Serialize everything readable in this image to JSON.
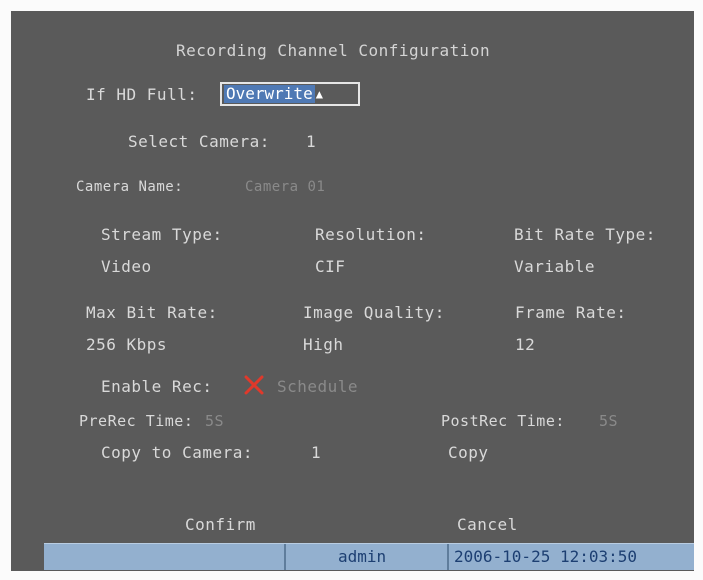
{
  "title": "Recording Channel Configuration",
  "hd_full": {
    "label": "If HD Full:",
    "value": "Overwrite"
  },
  "camera": {
    "label": "Select Camera:",
    "value": "1"
  },
  "camera_name": {
    "label": "Camera Name:",
    "value": "Camera 01"
  },
  "grid": {
    "stream_type": {
      "label": "Stream Type:",
      "value": "Video"
    },
    "resolution": {
      "label": "Resolution:",
      "value": "CIF"
    },
    "bit_rate_type": {
      "label": "Bit Rate Type:",
      "value": "Variable"
    },
    "max_bit_rate": {
      "label": "Max Bit Rate:",
      "value": "256 Kbps"
    },
    "image_quality": {
      "label": "Image Quality:",
      "value": "High"
    },
    "frame_rate": {
      "label": "Frame Rate:",
      "value": "12"
    }
  },
  "enable_rec": {
    "label": "Enable Rec:",
    "checked": false,
    "mark_color": "#e0392b"
  },
  "schedule_label": "Schedule",
  "prerec": {
    "label": "PreRec Time:",
    "value": "5S"
  },
  "postrec": {
    "label": "PostRec Time:",
    "value": "5S"
  },
  "copy_to": {
    "label": "Copy to Camera:",
    "value": "1"
  },
  "copy_button": "Copy",
  "confirm_button": "Confirm",
  "cancel_button": "Cancel",
  "status_bar": {
    "user": "admin",
    "datetime": "2006-10-25 12:03:50"
  }
}
